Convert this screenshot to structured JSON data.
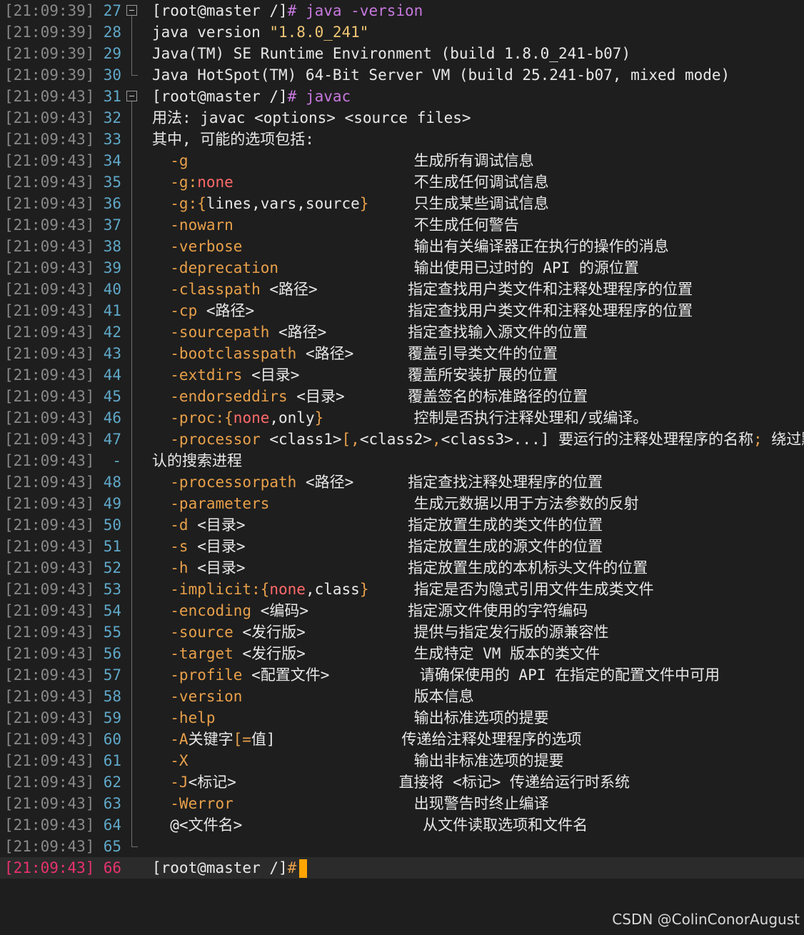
{
  "watermark": "CSDN @ColinConorAugust",
  "lines": [
    {
      "ts": "[21:09:39]",
      "ln": "27",
      "fold": "box",
      "segs": [
        [
          "w",
          "[root@master /]"
        ],
        [
          "p",
          "# java -version"
        ]
      ]
    },
    {
      "ts": "[21:09:39]",
      "ln": "28",
      "fold": "bar",
      "segs": [
        [
          "w",
          "java version "
        ],
        [
          "s",
          "\"1.8.0_241\""
        ]
      ]
    },
    {
      "ts": "[21:09:39]",
      "ln": "29",
      "fold": "bar",
      "segs": [
        [
          "w",
          "Java(TM) SE Runtime Environment (build 1.8.0_241-b07)"
        ]
      ]
    },
    {
      "ts": "[21:09:39]",
      "ln": "30",
      "fold": "end",
      "segs": [
        [
          "w",
          "Java HotSpot(TM) 64-Bit Server VM (build 25.241-b07, mixed mode)"
        ]
      ]
    },
    {
      "ts": "[21:09:43]",
      "ln": "31",
      "fold": "box",
      "segs": [
        [
          "w",
          "[root@master /]"
        ],
        [
          "p",
          "# javac"
        ]
      ]
    },
    {
      "ts": "[21:09:43]",
      "ln": "32",
      "fold": "bar",
      "segs": [
        [
          "w",
          "用法: javac <options> <source files>"
        ]
      ]
    },
    {
      "ts": "[21:09:43]",
      "ln": "33",
      "fold": "bar",
      "segs": [
        [
          "w",
          "其中, 可能的选项包括:"
        ]
      ]
    },
    {
      "ts": "[21:09:43]",
      "ln": "34",
      "fold": "bar",
      "segs": [
        [
          "o",
          "  -g                         "
        ],
        [
          "w",
          "生成所有调试信息"
        ]
      ]
    },
    {
      "ts": "[21:09:43]",
      "ln": "35",
      "fold": "bar",
      "segs": [
        [
          "o",
          "  -g:"
        ],
        [
          "cn",
          "none"
        ],
        [
          "w",
          "                    不生成任何调试信息"
        ]
      ]
    },
    {
      "ts": "[21:09:43]",
      "ln": "36",
      "fold": "bar",
      "segs": [
        [
          "o",
          "  -g:{"
        ],
        [
          "w",
          "lines,vars,source"
        ],
        [
          "o",
          "}"
        ],
        [
          "w",
          "     只生成某些调试信息"
        ]
      ]
    },
    {
      "ts": "[21:09:43]",
      "ln": "37",
      "fold": "bar",
      "segs": [
        [
          "o",
          "  -nowarn                    "
        ],
        [
          "w",
          "不生成任何警告"
        ]
      ]
    },
    {
      "ts": "[21:09:43]",
      "ln": "38",
      "fold": "bar",
      "segs": [
        [
          "o",
          "  -verbose                   "
        ],
        [
          "w",
          "输出有关编译器正在执行的操作的消息"
        ]
      ]
    },
    {
      "ts": "[21:09:43]",
      "ln": "39",
      "fold": "bar",
      "segs": [
        [
          "o",
          "  -deprecation               "
        ],
        [
          "w",
          "输出使用已过时的 API 的源位置"
        ]
      ]
    },
    {
      "ts": "[21:09:43]",
      "ln": "40",
      "fold": "bar",
      "segs": [
        [
          "o",
          "  -classpath "
        ],
        [
          "w",
          "<路径>          指定查找用户类文件和注释处理程序的位置"
        ]
      ]
    },
    {
      "ts": "[21:09:43]",
      "ln": "41",
      "fold": "bar",
      "segs": [
        [
          "o",
          "  -cp "
        ],
        [
          "w",
          "<路径>                 指定查找用户类文件和注释处理程序的位置"
        ]
      ]
    },
    {
      "ts": "[21:09:43]",
      "ln": "42",
      "fold": "bar",
      "segs": [
        [
          "o",
          "  -sourcepath "
        ],
        [
          "w",
          "<路径>         指定查找输入源文件的位置"
        ]
      ]
    },
    {
      "ts": "[21:09:43]",
      "ln": "43",
      "fold": "bar",
      "segs": [
        [
          "o",
          "  -bootclasspath "
        ],
        [
          "w",
          "<路径>      覆盖引导类文件的位置"
        ]
      ]
    },
    {
      "ts": "[21:09:43]",
      "ln": "44",
      "fold": "bar",
      "segs": [
        [
          "o",
          "  -extdirs "
        ],
        [
          "w",
          "<目录>            覆盖所安装扩展的位置"
        ]
      ]
    },
    {
      "ts": "[21:09:43]",
      "ln": "45",
      "fold": "bar",
      "segs": [
        [
          "o",
          "  -endorseddirs "
        ],
        [
          "w",
          "<目录>       覆盖签名的标准路径的位置"
        ]
      ]
    },
    {
      "ts": "[21:09:43]",
      "ln": "46",
      "fold": "bar",
      "segs": [
        [
          "o",
          "  -proc:{"
        ],
        [
          "cn",
          "none"
        ],
        [
          "w",
          ",only"
        ],
        [
          "o",
          "}"
        ],
        [
          "w",
          "          控制是否执行注释处理和/或编译。"
        ]
      ]
    },
    {
      "ts": "[21:09:43]",
      "ln": "47",
      "fold": "bar",
      "segs": [
        [
          "o",
          "  -processor "
        ],
        [
          "w",
          "<class1>"
        ],
        [
          "o",
          "[,"
        ],
        [
          "w",
          "<class2>"
        ],
        [
          "o",
          ","
        ],
        [
          "w",
          "<class3>...] 要运行的注释处理程序的名称"
        ],
        [
          "o",
          ";"
        ],
        [
          "w",
          " 绕过默 "
        ],
        [
          "x",
          "↩"
        ]
      ]
    },
    {
      "ts": "[21:09:43]",
      "ln": "-",
      "fold": "bar",
      "segs": [
        [
          "w",
          "认的搜索进程"
        ]
      ]
    },
    {
      "ts": "[21:09:43]",
      "ln": "48",
      "fold": "bar",
      "segs": [
        [
          "o",
          "  -processorpath "
        ],
        [
          "w",
          "<路径>      指定查找注释处理程序的位置"
        ]
      ]
    },
    {
      "ts": "[21:09:43]",
      "ln": "49",
      "fold": "bar",
      "segs": [
        [
          "o",
          "  -parameters                "
        ],
        [
          "w",
          "生成元数据以用于方法参数的反射"
        ]
      ]
    },
    {
      "ts": "[21:09:43]",
      "ln": "50",
      "fold": "bar",
      "segs": [
        [
          "o",
          "  -d "
        ],
        [
          "w",
          "<目录>                  指定放置生成的类文件的位置"
        ]
      ]
    },
    {
      "ts": "[21:09:43]",
      "ln": "51",
      "fold": "bar",
      "segs": [
        [
          "o",
          "  -s "
        ],
        [
          "w",
          "<目录>                  指定放置生成的源文件的位置"
        ]
      ]
    },
    {
      "ts": "[21:09:43]",
      "ln": "52",
      "fold": "bar",
      "segs": [
        [
          "o",
          "  -h "
        ],
        [
          "w",
          "<目录>                  指定放置生成的本机标头文件的位置"
        ]
      ]
    },
    {
      "ts": "[21:09:43]",
      "ln": "53",
      "fold": "bar",
      "segs": [
        [
          "o",
          "  -implicit:{"
        ],
        [
          "cn",
          "none"
        ],
        [
          "w",
          ",class"
        ],
        [
          "o",
          "}"
        ],
        [
          "w",
          "     指定是否为隐式引用文件生成类文件"
        ]
      ]
    },
    {
      "ts": "[21:09:43]",
      "ln": "54",
      "fold": "bar",
      "segs": [
        [
          "o",
          "  -encoding "
        ],
        [
          "w",
          "<编码>           指定源文件使用的字符编码"
        ]
      ]
    },
    {
      "ts": "[21:09:43]",
      "ln": "55",
      "fold": "bar",
      "segs": [
        [
          "o",
          "  -source "
        ],
        [
          "w",
          "<发行版>            提供与指定发行版的源兼容性"
        ]
      ]
    },
    {
      "ts": "[21:09:43]",
      "ln": "56",
      "fold": "bar",
      "segs": [
        [
          "o",
          "  -target "
        ],
        [
          "w",
          "<发行版>            生成特定 VM 版本的类文件"
        ]
      ]
    },
    {
      "ts": "[21:09:43]",
      "ln": "57",
      "fold": "bar",
      "segs": [
        [
          "o",
          "  -profile "
        ],
        [
          "w",
          "<配置文件>          请确保使用的 API 在指定的配置文件中可用"
        ]
      ]
    },
    {
      "ts": "[21:09:43]",
      "ln": "58",
      "fold": "bar",
      "segs": [
        [
          "o",
          "  -version                   "
        ],
        [
          "w",
          "版本信息"
        ]
      ]
    },
    {
      "ts": "[21:09:43]",
      "ln": "59",
      "fold": "bar",
      "segs": [
        [
          "o",
          "  -help                      "
        ],
        [
          "w",
          "输出标准选项的提要"
        ]
      ]
    },
    {
      "ts": "[21:09:43]",
      "ln": "60",
      "fold": "bar",
      "segs": [
        [
          "o",
          "  -A"
        ],
        [
          "w",
          "关键字"
        ],
        [
          "o",
          "[="
        ],
        [
          "w",
          "值]              传递给注释处理程序的选项"
        ]
      ]
    },
    {
      "ts": "[21:09:43]",
      "ln": "61",
      "fold": "bar",
      "segs": [
        [
          "o",
          "  -X                         "
        ],
        [
          "w",
          "输出非标准选项的提要"
        ]
      ]
    },
    {
      "ts": "[21:09:43]",
      "ln": "62",
      "fold": "bar",
      "segs": [
        [
          "o",
          "  -J"
        ],
        [
          "w",
          "<标记>                  直接将 <标记> 传递给运行时系统"
        ]
      ]
    },
    {
      "ts": "[21:09:43]",
      "ln": "63",
      "fold": "bar",
      "segs": [
        [
          "o",
          "  -Werror                    "
        ],
        [
          "w",
          "出现警告时终止编译"
        ]
      ]
    },
    {
      "ts": "[21:09:43]",
      "ln": "64",
      "fold": "bar",
      "segs": [
        [
          "w",
          "  @<文件名>                    从文件读取选项和文件名"
        ]
      ]
    },
    {
      "ts": "[21:09:43]",
      "ln": "65",
      "fold": "end",
      "segs": []
    },
    {
      "ts": "[21:09:43]",
      "ln": "66",
      "fold": "none",
      "active": true,
      "cursor": true,
      "segs": [
        [
          "w",
          "[root@master /]"
        ],
        [
          "o",
          "#"
        ]
      ]
    }
  ]
}
